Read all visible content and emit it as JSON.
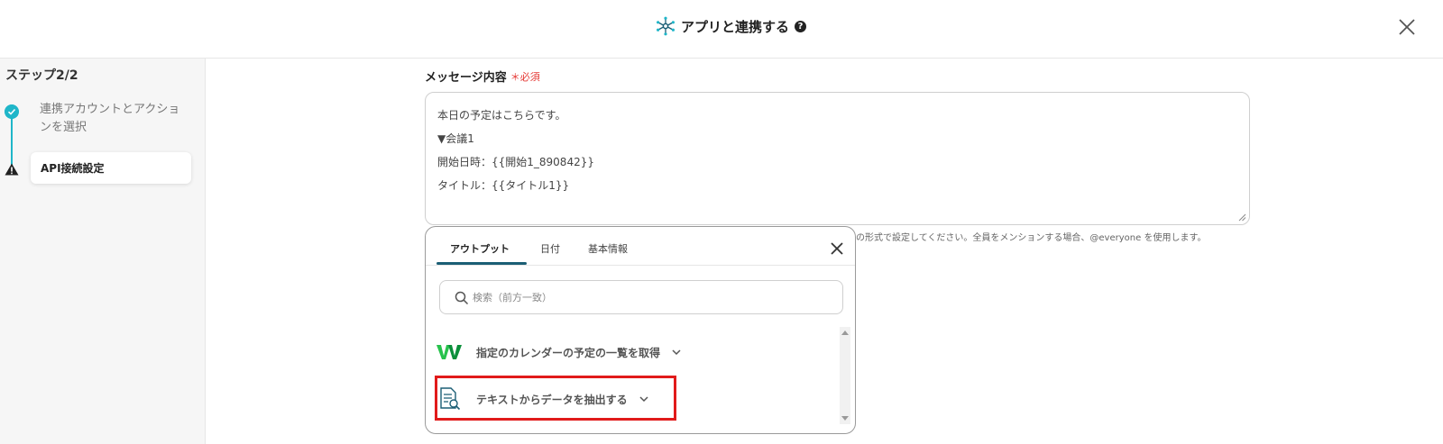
{
  "header": {
    "title": "アプリと連携する",
    "help_icon": "question-circle-icon",
    "close_icon": "close-icon"
  },
  "sidebar": {
    "step_title": "ステップ2/2",
    "steps": [
      {
        "label": "連携アカウントとアクションを選択",
        "status": "done",
        "icon": "check-circle-icon"
      },
      {
        "label": "API接続設定",
        "status": "warning",
        "icon": "warning-icon"
      }
    ]
  },
  "message_field": {
    "label": "メッセージ内容",
    "required_label": "＊必須",
    "lines": [
      "本日の予定はこちらです。",
      "▼会議1",
      "開始日時：{{開始1_890842}}",
      "タイトル：{{タイトル1}}"
    ],
    "hint": "の形式で設定してください。全員をメンションする場合、@everyone を使用します。"
  },
  "popup": {
    "tabs": [
      {
        "label": "アウトプット",
        "active": true
      },
      {
        "label": "日付",
        "active": false
      },
      {
        "label": "基本情報",
        "active": false
      }
    ],
    "search_placeholder": "検索（前方一致）",
    "items": [
      {
        "label": "指定のカレンダーの予定の一覧を取得",
        "icon": "app-logo-icon"
      },
      {
        "label": "テキストからデータを抽出する",
        "icon": "document-search-icon",
        "highlighted": true
      }
    ]
  },
  "colors": {
    "accent": "#1fb6c9",
    "tab_underline": "#1b5e75",
    "highlight": "#e11a1a",
    "required": "#e53935"
  }
}
